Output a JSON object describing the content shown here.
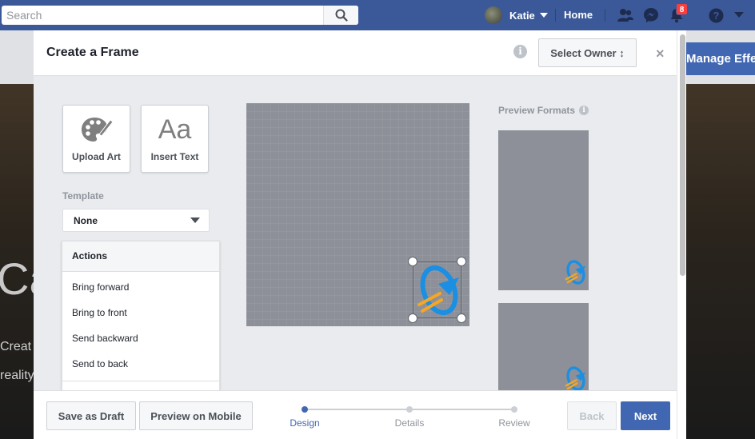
{
  "topbar": {
    "search_placeholder": "Search",
    "profile_name": "Katie",
    "home_label": "Home",
    "notification_count": "8",
    "icons": [
      "search-icon",
      "friend-requests-icon",
      "messenger-icon",
      "notifications-icon",
      "help-icon",
      "account-menu-icon"
    ]
  },
  "background": {
    "manage_label": "Manage Effe",
    "big_text": "Ca",
    "line1": "Creat",
    "line2": "reality"
  },
  "modal": {
    "title": "Create a Frame",
    "select_owner_label": "Select Owner ↕",
    "close_label": "×",
    "info_icon": "i"
  },
  "tools": {
    "upload_label": "Upload Art",
    "insert_text_label": "Insert Text",
    "insert_text_glyph": "Aa"
  },
  "template": {
    "label": "Template",
    "value": "None"
  },
  "actions": {
    "header": "Actions",
    "items": [
      "Bring forward",
      "Bring to front",
      "Send backward",
      "Send to back"
    ]
  },
  "preview": {
    "label": "Preview Formats",
    "info_icon": "i"
  },
  "footer": {
    "save_draft": "Save as Draft",
    "preview_mobile": "Preview on Mobile",
    "steps": [
      "Design",
      "Details",
      "Review"
    ],
    "active_step": "Design",
    "back": "Back",
    "next": "Next"
  },
  "colors": {
    "brand": "#3b5998",
    "primary_button": "#4267b2",
    "canvas": "#8d9098",
    "logo_blue": "#1a8fe3",
    "logo_orange": "#f5a623"
  }
}
